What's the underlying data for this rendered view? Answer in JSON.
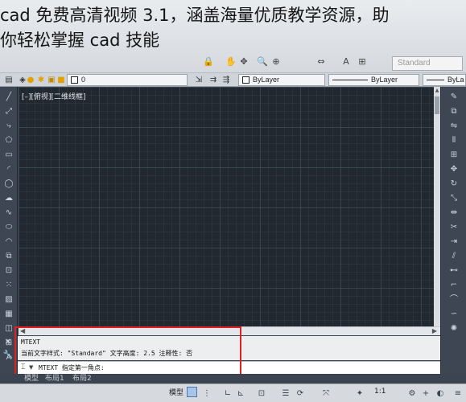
{
  "overlay_title": {
    "line1": "cad 免费高清视频 3.1，涵盖海量优质教学资源，助",
    "line2": "你轻松掌握 cad 技能"
  },
  "ribbon": {
    "text_style_box": "Standard"
  },
  "properties_bar": {
    "layer_value": "0",
    "color_value": "ByLayer",
    "linetype_value": "ByLayer",
    "lineweight_value": "ByLa"
  },
  "viewport_label": "[–][俯视][二维线框]",
  "command_window": {
    "history": [
      "MTEXT",
      "当前文字样式: \"Standard\"  文字高度:  2.5  注释性:  否"
    ],
    "prompt_command": "MTEXT",
    "prompt_text": "指定第一角点:"
  },
  "layout_tabs": [
    "模型",
    "布局1",
    "布局2"
  ],
  "status_bar": {
    "model_label": "模型",
    "scale_label": "1:1"
  },
  "colors": {
    "canvas_bg": "#212830",
    "highlight": "#e12020",
    "chrome": "#3e4653"
  },
  "icons": {
    "left_tools": [
      "line-icon",
      "polyline-icon",
      "circle-icon",
      "arc-icon",
      "rectangle-icon",
      "hatch-icon",
      "text-icon",
      "table-icon"
    ],
    "right_tools": [
      "move-icon",
      "copy-icon",
      "rotate-icon",
      "mirror-icon",
      "scale-icon",
      "trim-icon",
      "fillet-icon",
      "explode-icon"
    ]
  }
}
